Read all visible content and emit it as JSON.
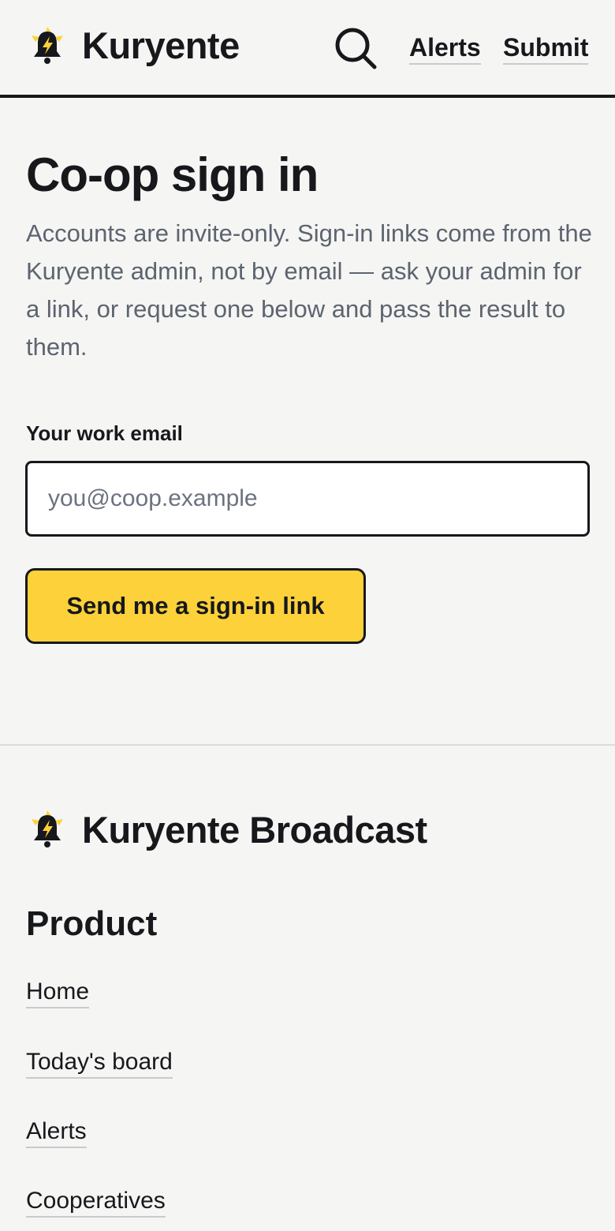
{
  "header": {
    "brand": "Kuryente",
    "logo_icon": "bell-bolt-icon",
    "search_icon": "search-icon",
    "nav": [
      {
        "label": "Alerts"
      },
      {
        "label": "Submit"
      }
    ]
  },
  "main": {
    "title": "Co-op sign in",
    "intro": "Accounts are invite-only. Sign-in links come from the Kuryente admin, not by email — ask your admin for a link, or request one below and pass the result to them.",
    "email_label": "Your work email",
    "email_placeholder": "you@coop.example",
    "email_value": "",
    "submit_label": "Send me a sign-in link"
  },
  "footer": {
    "brand": "Kuryente Broadcast",
    "section_heading": "Product",
    "links": [
      {
        "label": "Home"
      },
      {
        "label": "Today's board"
      },
      {
        "label": "Alerts"
      },
      {
        "label": "Cooperatives"
      }
    ]
  },
  "colors": {
    "accent": "#fdd13a",
    "text": "#17181c",
    "muted": "#5d6470",
    "background": "#f5f5f3"
  }
}
